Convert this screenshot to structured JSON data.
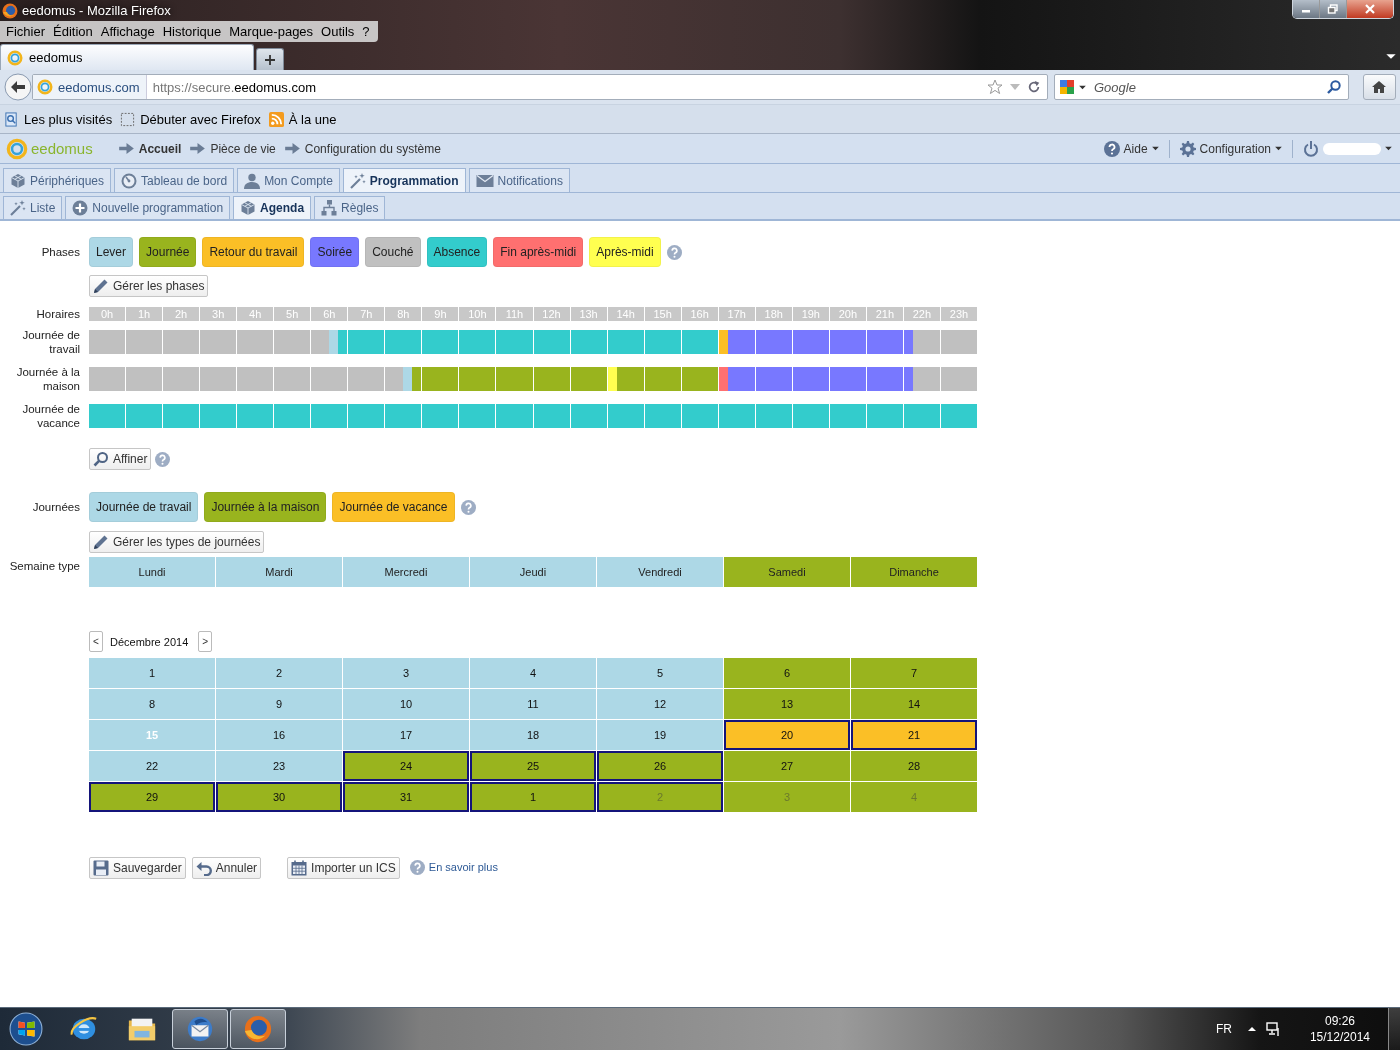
{
  "browser": {
    "title": "eedomus - Mozilla Firefox",
    "menu": [
      "Fichier",
      "Édition",
      "Affichage",
      "Historique",
      "Marque-pages",
      "Outils",
      "?"
    ],
    "tabs": [
      {
        "label": "eedomus",
        "selected": true
      }
    ],
    "identity": "eedomus.com",
    "url_prefix": "https://secure.",
    "url_host": "eedomus.com",
    "search": {
      "placeholder": "Google"
    },
    "bookmarks": [
      "Les plus visités",
      "Débuter avec Firefox",
      "À la une"
    ]
  },
  "app": {
    "logo": "eedomus",
    "breadcrumb": [
      {
        "label": "Accueil",
        "kind": "home"
      },
      {
        "label": "Pièce de vie",
        "kind": "link"
      },
      {
        "label": "Configuration du système",
        "kind": "link"
      }
    ],
    "header_menu": [
      "Aide",
      "Configuration"
    ],
    "main_tabs": [
      {
        "label": "Périphériques",
        "selected": false
      },
      {
        "label": "Tableau de bord",
        "selected": false
      },
      {
        "label": "Mon Compte",
        "selected": false
      },
      {
        "label": "Programmation",
        "selected": true
      },
      {
        "label": "Notifications",
        "selected": false
      }
    ],
    "sub_tabs": [
      {
        "label": "Liste",
        "selected": false
      },
      {
        "label": "Nouvelle programmation",
        "selected": false
      },
      {
        "label": "Agenda",
        "selected": true
      },
      {
        "label": "Règles",
        "selected": false
      }
    ]
  },
  "phases": {
    "label": "Phases",
    "manage_button": "Gérer les phases",
    "items": [
      {
        "label": "Lever",
        "color": "#add8e6"
      },
      {
        "label": "Journée",
        "color": "#99b41e"
      },
      {
        "label": "Retour du travail",
        "color": "#fbbf26"
      },
      {
        "label": "Soirée",
        "color": "#7878ff"
      },
      {
        "label": "Couché",
        "color": "#c0c0c0"
      },
      {
        "label": "Absence",
        "color": "#33cccc"
      },
      {
        "label": "Fin après-midi",
        "color": "#ff7070"
      },
      {
        "label": "Après-midi",
        "color": "#ffff50"
      }
    ]
  },
  "schedule": {
    "label": "Horaires",
    "refine_button": "Affiner",
    "hours": [
      "0h",
      "1h",
      "2h",
      "3h",
      "4h",
      "5h",
      "6h",
      "7h",
      "8h",
      "9h",
      "10h",
      "11h",
      "12h",
      "13h",
      "14h",
      "15h",
      "16h",
      "17h",
      "18h",
      "19h",
      "20h",
      "21h",
      "22h",
      "23h"
    ],
    "rows": [
      {
        "label": "Journée de travail",
        "hours": [
          {
            "quarters": [
              {
                "color": "#c0c0c0"
              },
              {
                "color": "#c0c0c0"
              },
              {
                "color": "#c0c0c0"
              },
              {
                "color": "#c0c0c0"
              }
            ]
          },
          {
            "quarters": [
              {
                "color": "#c0c0c0"
              },
              {
                "color": "#c0c0c0"
              },
              {
                "color": "#c0c0c0"
              },
              {
                "color": "#c0c0c0"
              }
            ]
          },
          {
            "quarters": [
              {
                "color": "#c0c0c0"
              },
              {
                "color": "#c0c0c0"
              },
              {
                "color": "#c0c0c0"
              },
              {
                "color": "#c0c0c0"
              }
            ]
          },
          {
            "quarters": [
              {
                "color": "#c0c0c0"
              },
              {
                "color": "#c0c0c0"
              },
              {
                "color": "#c0c0c0"
              },
              {
                "color": "#c0c0c0"
              }
            ]
          },
          {
            "quarters": [
              {
                "color": "#c0c0c0"
              },
              {
                "color": "#c0c0c0"
              },
              {
                "color": "#c0c0c0"
              },
              {
                "color": "#c0c0c0"
              }
            ]
          },
          {
            "quarters": [
              {
                "color": "#c0c0c0"
              },
              {
                "color": "#c0c0c0"
              },
              {
                "color": "#c0c0c0"
              },
              {
                "color": "#c0c0c0"
              }
            ]
          },
          {
            "quarters": [
              {
                "color": "#c0c0c0"
              },
              {
                "color": "#c0c0c0"
              },
              {
                "color": "#add8e6"
              },
              {
                "color": "#33cccc"
              }
            ]
          },
          {
            "quarters": [
              {
                "color": "#33cccc"
              },
              {
                "color": "#33cccc"
              },
              {
                "color": "#33cccc"
              },
              {
                "color": "#33cccc"
              }
            ]
          },
          {
            "quarters": [
              {
                "color": "#33cccc"
              },
              {
                "color": "#33cccc"
              },
              {
                "color": "#33cccc"
              },
              {
                "color": "#33cccc"
              }
            ]
          },
          {
            "quarters": [
              {
                "color": "#33cccc"
              },
              {
                "color": "#33cccc"
              },
              {
                "color": "#33cccc"
              },
              {
                "color": "#33cccc"
              }
            ]
          },
          {
            "quarters": [
              {
                "color": "#33cccc"
              },
              {
                "color": "#33cccc"
              },
              {
                "color": "#33cccc"
              },
              {
                "color": "#33cccc"
              }
            ]
          },
          {
            "quarters": [
              {
                "color": "#33cccc"
              },
              {
                "color": "#33cccc"
              },
              {
                "color": "#33cccc"
              },
              {
                "color": "#33cccc"
              }
            ]
          },
          {
            "quarters": [
              {
                "color": "#33cccc"
              },
              {
                "color": "#33cccc"
              },
              {
                "color": "#33cccc"
              },
              {
                "color": "#33cccc"
              }
            ]
          },
          {
            "quarters": [
              {
                "color": "#33cccc"
              },
              {
                "color": "#33cccc"
              },
              {
                "color": "#33cccc"
              },
              {
                "color": "#33cccc"
              }
            ]
          },
          {
            "quarters": [
              {
                "color": "#33cccc"
              },
              {
                "color": "#33cccc"
              },
              {
                "color": "#33cccc"
              },
              {
                "color": "#33cccc"
              }
            ]
          },
          {
            "quarters": [
              {
                "color": "#33cccc"
              },
              {
                "color": "#33cccc"
              },
              {
                "color": "#33cccc"
              },
              {
                "color": "#33cccc"
              }
            ]
          },
          {
            "quarters": [
              {
                "color": "#33cccc"
              },
              {
                "color": "#33cccc"
              },
              {
                "color": "#33cccc"
              },
              {
                "color": "#33cccc"
              }
            ]
          },
          {
            "quarters": [
              {
                "color": "#fbbf26"
              },
              {
                "color": "#7878ff"
              },
              {
                "color": "#7878ff"
              },
              {
                "color": "#7878ff"
              }
            ]
          },
          {
            "quarters": [
              {
                "color": "#7878ff"
              },
              {
                "color": "#7878ff"
              },
              {
                "color": "#7878ff"
              },
              {
                "color": "#7878ff"
              }
            ]
          },
          {
            "quarters": [
              {
                "color": "#7878ff"
              },
              {
                "color": "#7878ff"
              },
              {
                "color": "#7878ff"
              },
              {
                "color": "#7878ff"
              }
            ]
          },
          {
            "quarters": [
              {
                "color": "#7878ff"
              },
              {
                "color": "#7878ff"
              },
              {
                "color": "#7878ff"
              },
              {
                "color": "#7878ff"
              }
            ]
          },
          {
            "quarters": [
              {
                "color": "#7878ff"
              },
              {
                "color": "#7878ff"
              },
              {
                "color": "#7878ff"
              },
              {
                "color": "#7878ff"
              }
            ]
          },
          {
            "quarters": [
              {
                "color": "#7878ff"
              },
              {
                "color": "#c0c0c0"
              },
              {
                "color": "#c0c0c0"
              },
              {
                "color": "#c0c0c0"
              }
            ]
          },
          {
            "quarters": [
              {
                "color": "#c0c0c0"
              },
              {
                "color": "#c0c0c0"
              },
              {
                "color": "#c0c0c0"
              },
              {
                "color": "#c0c0c0"
              }
            ]
          }
        ]
      },
      {
        "label": "Journée à la maison",
        "hours": [
          {
            "quarters": [
              {
                "color": "#c0c0c0"
              },
              {
                "color": "#c0c0c0"
              },
              {
                "color": "#c0c0c0"
              },
              {
                "color": "#c0c0c0"
              }
            ]
          },
          {
            "quarters": [
              {
                "color": "#c0c0c0"
              },
              {
                "color": "#c0c0c0"
              },
              {
                "color": "#c0c0c0"
              },
              {
                "color": "#c0c0c0"
              }
            ]
          },
          {
            "quarters": [
              {
                "color": "#c0c0c0"
              },
              {
                "color": "#c0c0c0"
              },
              {
                "color": "#c0c0c0"
              },
              {
                "color": "#c0c0c0"
              }
            ]
          },
          {
            "quarters": [
              {
                "color": "#c0c0c0"
              },
              {
                "color": "#c0c0c0"
              },
              {
                "color": "#c0c0c0"
              },
              {
                "color": "#c0c0c0"
              }
            ]
          },
          {
            "quarters": [
              {
                "color": "#c0c0c0"
              },
              {
                "color": "#c0c0c0"
              },
              {
                "color": "#c0c0c0"
              },
              {
                "color": "#c0c0c0"
              }
            ]
          },
          {
            "quarters": [
              {
                "color": "#c0c0c0"
              },
              {
                "color": "#c0c0c0"
              },
              {
                "color": "#c0c0c0"
              },
              {
                "color": "#c0c0c0"
              }
            ]
          },
          {
            "quarters": [
              {
                "color": "#c0c0c0"
              },
              {
                "color": "#c0c0c0"
              },
              {
                "color": "#c0c0c0"
              },
              {
                "color": "#c0c0c0"
              }
            ]
          },
          {
            "quarters": [
              {
                "color": "#c0c0c0"
              },
              {
                "color": "#c0c0c0"
              },
              {
                "color": "#c0c0c0"
              },
              {
                "color": "#c0c0c0"
              }
            ]
          },
          {
            "quarters": [
              {
                "color": "#c0c0c0"
              },
              {
                "color": "#c0c0c0"
              },
              {
                "color": "#add8e6"
              },
              {
                "color": "#99b41e"
              }
            ]
          },
          {
            "quarters": [
              {
                "color": "#99b41e"
              },
              {
                "color": "#99b41e"
              },
              {
                "color": "#99b41e"
              },
              {
                "color": "#99b41e"
              }
            ]
          },
          {
            "quarters": [
              {
                "color": "#99b41e"
              },
              {
                "color": "#99b41e"
              },
              {
                "color": "#99b41e"
              },
              {
                "color": "#99b41e"
              }
            ]
          },
          {
            "quarters": [
              {
                "color": "#99b41e"
              },
              {
                "color": "#99b41e"
              },
              {
                "color": "#99b41e"
              },
              {
                "color": "#99b41e"
              }
            ]
          },
          {
            "quarters": [
              {
                "color": "#99b41e"
              },
              {
                "color": "#99b41e"
              },
              {
                "color": "#99b41e"
              },
              {
                "color": "#99b41e"
              }
            ]
          },
          {
            "quarters": [
              {
                "color": "#99b41e"
              },
              {
                "color": "#99b41e"
              },
              {
                "color": "#99b41e"
              },
              {
                "color": "#99b41e"
              }
            ]
          },
          {
            "quarters": [
              {
                "color": "#ffff50"
              },
              {
                "color": "#99b41e"
              },
              {
                "color": "#99b41e"
              },
              {
                "color": "#99b41e"
              }
            ]
          },
          {
            "quarters": [
              {
                "color": "#99b41e"
              },
              {
                "color": "#99b41e"
              },
              {
                "color": "#99b41e"
              },
              {
                "color": "#99b41e"
              }
            ]
          },
          {
            "quarters": [
              {
                "color": "#99b41e"
              },
              {
                "color": "#99b41e"
              },
              {
                "color": "#99b41e"
              },
              {
                "color": "#99b41e"
              }
            ]
          },
          {
            "quarters": [
              {
                "color": "#ff7070"
              },
              {
                "color": "#7878ff"
              },
              {
                "color": "#7878ff"
              },
              {
                "color": "#7878ff"
              }
            ]
          },
          {
            "quarters": [
              {
                "color": "#7878ff"
              },
              {
                "color": "#7878ff"
              },
              {
                "color": "#7878ff"
              },
              {
                "color": "#7878ff"
              }
            ]
          },
          {
            "quarters": [
              {
                "color": "#7878ff"
              },
              {
                "color": "#7878ff"
              },
              {
                "color": "#7878ff"
              },
              {
                "color": "#7878ff"
              }
            ]
          },
          {
            "quarters": [
              {
                "color": "#7878ff"
              },
              {
                "color": "#7878ff"
              },
              {
                "color": "#7878ff"
              },
              {
                "color": "#7878ff"
              }
            ]
          },
          {
            "quarters": [
              {
                "color": "#7878ff"
              },
              {
                "color": "#7878ff"
              },
              {
                "color": "#7878ff"
              },
              {
                "color": "#7878ff"
              }
            ]
          },
          {
            "quarters": [
              {
                "color": "#7878ff"
              },
              {
                "color": "#c0c0c0"
              },
              {
                "color": "#c0c0c0"
              },
              {
                "color": "#c0c0c0"
              }
            ]
          },
          {
            "quarters": [
              {
                "color": "#c0c0c0"
              },
              {
                "color": "#c0c0c0"
              },
              {
                "color": "#c0c0c0"
              },
              {
                "color": "#c0c0c0"
              }
            ]
          }
        ]
      },
      {
        "label": "Journée de vacance",
        "hours": [
          {
            "quarters": [
              {
                "color": "#33cccc"
              },
              {
                "color": "#33cccc"
              },
              {
                "color": "#33cccc"
              },
              {
                "color": "#33cccc"
              }
            ]
          },
          {
            "quarters": [
              {
                "color": "#33cccc"
              },
              {
                "color": "#33cccc"
              },
              {
                "color": "#33cccc"
              },
              {
                "color": "#33cccc"
              }
            ]
          },
          {
            "quarters": [
              {
                "color": "#33cccc"
              },
              {
                "color": "#33cccc"
              },
              {
                "color": "#33cccc"
              },
              {
                "color": "#33cccc"
              }
            ]
          },
          {
            "quarters": [
              {
                "color": "#33cccc"
              },
              {
                "color": "#33cccc"
              },
              {
                "color": "#33cccc"
              },
              {
                "color": "#33cccc"
              }
            ]
          },
          {
            "quarters": [
              {
                "color": "#33cccc"
              },
              {
                "color": "#33cccc"
              },
              {
                "color": "#33cccc"
              },
              {
                "color": "#33cccc"
              }
            ]
          },
          {
            "quarters": [
              {
                "color": "#33cccc"
              },
              {
                "color": "#33cccc"
              },
              {
                "color": "#33cccc"
              },
              {
                "color": "#33cccc"
              }
            ]
          },
          {
            "quarters": [
              {
                "color": "#33cccc"
              },
              {
                "color": "#33cccc"
              },
              {
                "color": "#33cccc"
              },
              {
                "color": "#33cccc"
              }
            ]
          },
          {
            "quarters": [
              {
                "color": "#33cccc"
              },
              {
                "color": "#33cccc"
              },
              {
                "color": "#33cccc"
              },
              {
                "color": "#33cccc"
              }
            ]
          },
          {
            "quarters": [
              {
                "color": "#33cccc"
              },
              {
                "color": "#33cccc"
              },
              {
                "color": "#33cccc"
              },
              {
                "color": "#33cccc"
              }
            ]
          },
          {
            "quarters": [
              {
                "color": "#33cccc"
              },
              {
                "color": "#33cccc"
              },
              {
                "color": "#33cccc"
              },
              {
                "color": "#33cccc"
              }
            ]
          },
          {
            "quarters": [
              {
                "color": "#33cccc"
              },
              {
                "color": "#33cccc"
              },
              {
                "color": "#33cccc"
              },
              {
                "color": "#33cccc"
              }
            ]
          },
          {
            "quarters": [
              {
                "color": "#33cccc"
              },
              {
                "color": "#33cccc"
              },
              {
                "color": "#33cccc"
              },
              {
                "color": "#33cccc"
              }
            ]
          },
          {
            "quarters": [
              {
                "color": "#33cccc"
              },
              {
                "color": "#33cccc"
              },
              {
                "color": "#33cccc"
              },
              {
                "color": "#33cccc"
              }
            ]
          },
          {
            "quarters": [
              {
                "color": "#33cccc"
              },
              {
                "color": "#33cccc"
              },
              {
                "color": "#33cccc"
              },
              {
                "color": "#33cccc"
              }
            ]
          },
          {
            "quarters": [
              {
                "color": "#33cccc"
              },
              {
                "color": "#33cccc"
              },
              {
                "color": "#33cccc"
              },
              {
                "color": "#33cccc"
              }
            ]
          },
          {
            "quarters": [
              {
                "color": "#33cccc"
              },
              {
                "color": "#33cccc"
              },
              {
                "color": "#33cccc"
              },
              {
                "color": "#33cccc"
              }
            ]
          },
          {
            "quarters": [
              {
                "color": "#33cccc"
              },
              {
                "color": "#33cccc"
              },
              {
                "color": "#33cccc"
              },
              {
                "color": "#33cccc"
              }
            ]
          },
          {
            "quarters": [
              {
                "color": "#33cccc"
              },
              {
                "color": "#33cccc"
              },
              {
                "color": "#33cccc"
              },
              {
                "color": "#33cccc"
              }
            ]
          },
          {
            "quarters": [
              {
                "color": "#33cccc"
              },
              {
                "color": "#33cccc"
              },
              {
                "color": "#33cccc"
              },
              {
                "color": "#33cccc"
              }
            ]
          },
          {
            "quarters": [
              {
                "color": "#33cccc"
              },
              {
                "color": "#33cccc"
              },
              {
                "color": "#33cccc"
              },
              {
                "color": "#33cccc"
              }
            ]
          },
          {
            "quarters": [
              {
                "color": "#33cccc"
              },
              {
                "color": "#33cccc"
              },
              {
                "color": "#33cccc"
              },
              {
                "color": "#33cccc"
              }
            ]
          },
          {
            "quarters": [
              {
                "color": "#33cccc"
              },
              {
                "color": "#33cccc"
              },
              {
                "color": "#33cccc"
              },
              {
                "color": "#33cccc"
              }
            ]
          },
          {
            "quarters": [
              {
                "color": "#33cccc"
              },
              {
                "color": "#33cccc"
              },
              {
                "color": "#33cccc"
              },
              {
                "color": "#33cccc"
              }
            ]
          },
          {
            "quarters": [
              {
                "color": "#33cccc"
              },
              {
                "color": "#33cccc"
              },
              {
                "color": "#33cccc"
              },
              {
                "color": "#33cccc"
              }
            ]
          }
        ]
      }
    ]
  },
  "day_types": {
    "label": "Journées",
    "manage_button": "Gérer les types de journées",
    "items": [
      {
        "label": "Journée de travail",
        "color": "#add8e6"
      },
      {
        "label": "Journée à la maison",
        "color": "#99b41e"
      },
      {
        "label": "Journée de vacance",
        "color": "#fbbf26"
      }
    ]
  },
  "week": {
    "label": "Semaine type",
    "days": [
      {
        "label": "Lundi",
        "color": "#add8e6"
      },
      {
        "label": "Mardi",
        "color": "#add8e6"
      },
      {
        "label": "Mercredi",
        "color": "#add8e6"
      },
      {
        "label": "Jeudi",
        "color": "#add8e6"
      },
      {
        "label": "Vendredi",
        "color": "#add8e6"
      },
      {
        "label": "Samedi",
        "color": "#99b41e"
      },
      {
        "label": "Dimanche",
        "color": "#99b41e"
      }
    ]
  },
  "calendar": {
    "prev": "<",
    "month": "Décembre 2014",
    "next": ">",
    "cells": [
      {
        "day": "1",
        "color": "#add8e6",
        "selected": false,
        "dimmed": false,
        "today": false
      },
      {
        "day": "2",
        "color": "#add8e6",
        "selected": false,
        "dimmed": false,
        "today": false
      },
      {
        "day": "3",
        "color": "#add8e6",
        "selected": false,
        "dimmed": false,
        "today": false
      },
      {
        "day": "4",
        "color": "#add8e6",
        "selected": false,
        "dimmed": false,
        "today": false
      },
      {
        "day": "5",
        "color": "#add8e6",
        "selected": false,
        "dimmed": false,
        "today": false
      },
      {
        "day": "6",
        "color": "#99b41e",
        "selected": false,
        "dimmed": false,
        "today": false
      },
      {
        "day": "7",
        "color": "#99b41e",
        "selected": false,
        "dimmed": false,
        "today": false
      },
      {
        "day": "8",
        "color": "#add8e6",
        "selected": false,
        "dimmed": false,
        "today": false
      },
      {
        "day": "9",
        "color": "#add8e6",
        "selected": false,
        "dimmed": false,
        "today": false
      },
      {
        "day": "10",
        "color": "#add8e6",
        "selected": false,
        "dimmed": false,
        "today": false
      },
      {
        "day": "11",
        "color": "#add8e6",
        "selected": false,
        "dimmed": false,
        "today": false
      },
      {
        "day": "12",
        "color": "#add8e6",
        "selected": false,
        "dimmed": false,
        "today": false
      },
      {
        "day": "13",
        "color": "#99b41e",
        "selected": false,
        "dimmed": false,
        "today": false
      },
      {
        "day": "14",
        "color": "#99b41e",
        "selected": false,
        "dimmed": false,
        "today": false
      },
      {
        "day": "15",
        "color": "#add8e6",
        "selected": false,
        "dimmed": false,
        "today": true
      },
      {
        "day": "16",
        "color": "#add8e6",
        "selected": false,
        "dimmed": false,
        "today": false
      },
      {
        "day": "17",
        "color": "#add8e6",
        "selected": false,
        "dimmed": false,
        "today": false
      },
      {
        "day": "18",
        "color": "#add8e6",
        "selected": false,
        "dimmed": false,
        "today": false
      },
      {
        "day": "19",
        "color": "#add8e6",
        "selected": false,
        "dimmed": false,
        "today": false
      },
      {
        "day": "20",
        "color": "#fbbf26",
        "selected": true,
        "dimmed": false,
        "today": false
      },
      {
        "day": "21",
        "color": "#fbbf26",
        "selected": true,
        "dimmed": false,
        "today": false
      },
      {
        "day": "22",
        "color": "#add8e6",
        "selected": false,
        "dimmed": false,
        "today": false
      },
      {
        "day": "23",
        "color": "#add8e6",
        "selected": false,
        "dimmed": false,
        "today": false
      },
      {
        "day": "24",
        "color": "#99b41e",
        "selected": true,
        "dimmed": false,
        "today": false
      },
      {
        "day": "25",
        "color": "#99b41e",
        "selected": true,
        "dimmed": false,
        "today": false
      },
      {
        "day": "26",
        "color": "#99b41e",
        "selected": true,
        "dimmed": false,
        "today": false
      },
      {
        "day": "27",
        "color": "#99b41e",
        "selected": false,
        "dimmed": false,
        "today": false
      },
      {
        "day": "28",
        "color": "#99b41e",
        "selected": false,
        "dimmed": false,
        "today": false
      },
      {
        "day": "29",
        "color": "#99b41e",
        "selected": true,
        "dimmed": false,
        "today": false
      },
      {
        "day": "30",
        "color": "#99b41e",
        "selected": true,
        "dimmed": false,
        "today": false
      },
      {
        "day": "31",
        "color": "#99b41e",
        "selected": true,
        "dimmed": false,
        "today": false
      },
      {
        "day": "1",
        "color": "#99b41e",
        "selected": true,
        "dimmed": false,
        "today": false
      },
      {
        "day": "2",
        "color": "#99b41e",
        "selected": true,
        "dimmed": true,
        "today": false
      },
      {
        "day": "3",
        "color": "#99b41e",
        "selected": false,
        "dimmed": true,
        "today": false
      },
      {
        "day": "4",
        "color": "#99b41e",
        "selected": false,
        "dimmed": true,
        "today": false
      }
    ]
  },
  "actions": [
    {
      "label": "Sauvegarder",
      "kind": "save"
    },
    {
      "label": "Annuler",
      "kind": "cancel"
    },
    {
      "label": "Importer un ICS",
      "kind": "import"
    }
  ],
  "help_link": "En savoir plus",
  "taskbar": {
    "language": "FR",
    "time": "09:26",
    "date": "15/12/2014"
  }
}
